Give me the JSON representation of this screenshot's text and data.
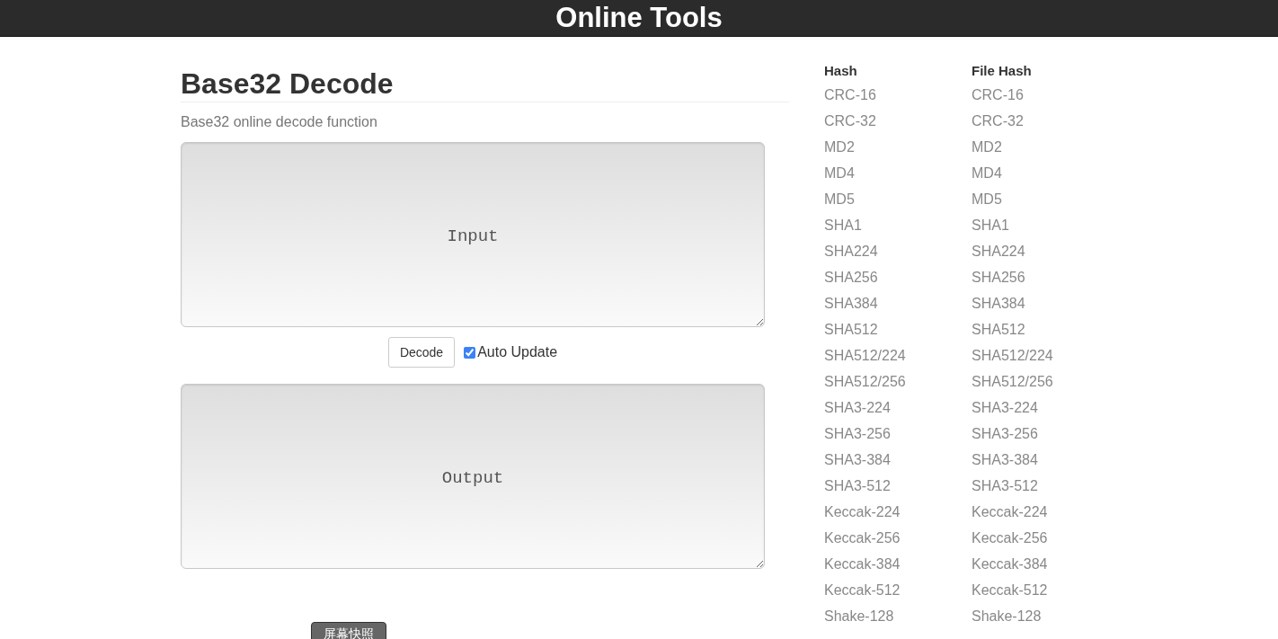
{
  "header": {
    "title": "Online Tools"
  },
  "page": {
    "title": "Base32 Decode",
    "description": "Base32 online decode function"
  },
  "input": {
    "placeholder": "Input"
  },
  "decode_button": "Decode",
  "auto_update": {
    "label": "Auto Update",
    "checked": true
  },
  "output": {
    "placeholder": "Output"
  },
  "screenshot_button": "屏幕快照",
  "sidebar": [
    {
      "heading": "Hash",
      "items": [
        "CRC-16",
        "CRC-32",
        "MD2",
        "MD4",
        "MD5",
        "SHA1",
        "SHA224",
        "SHA256",
        "SHA384",
        "SHA512",
        "SHA512/224",
        "SHA512/256",
        "SHA3-224",
        "SHA3-256",
        "SHA3-384",
        "SHA3-512",
        "Keccak-224",
        "Keccak-256",
        "Keccak-384",
        "Keccak-512",
        "Shake-128"
      ]
    },
    {
      "heading": "File Hash",
      "items": [
        "CRC-16",
        "CRC-32",
        "MD2",
        "MD4",
        "MD5",
        "SHA1",
        "SHA224",
        "SHA256",
        "SHA384",
        "SHA512",
        "SHA512/224",
        "SHA512/256",
        "SHA3-224",
        "SHA3-256",
        "SHA3-384",
        "SHA3-512",
        "Keccak-224",
        "Keccak-256",
        "Keccak-384",
        "Keccak-512",
        "Shake-128"
      ]
    }
  ]
}
